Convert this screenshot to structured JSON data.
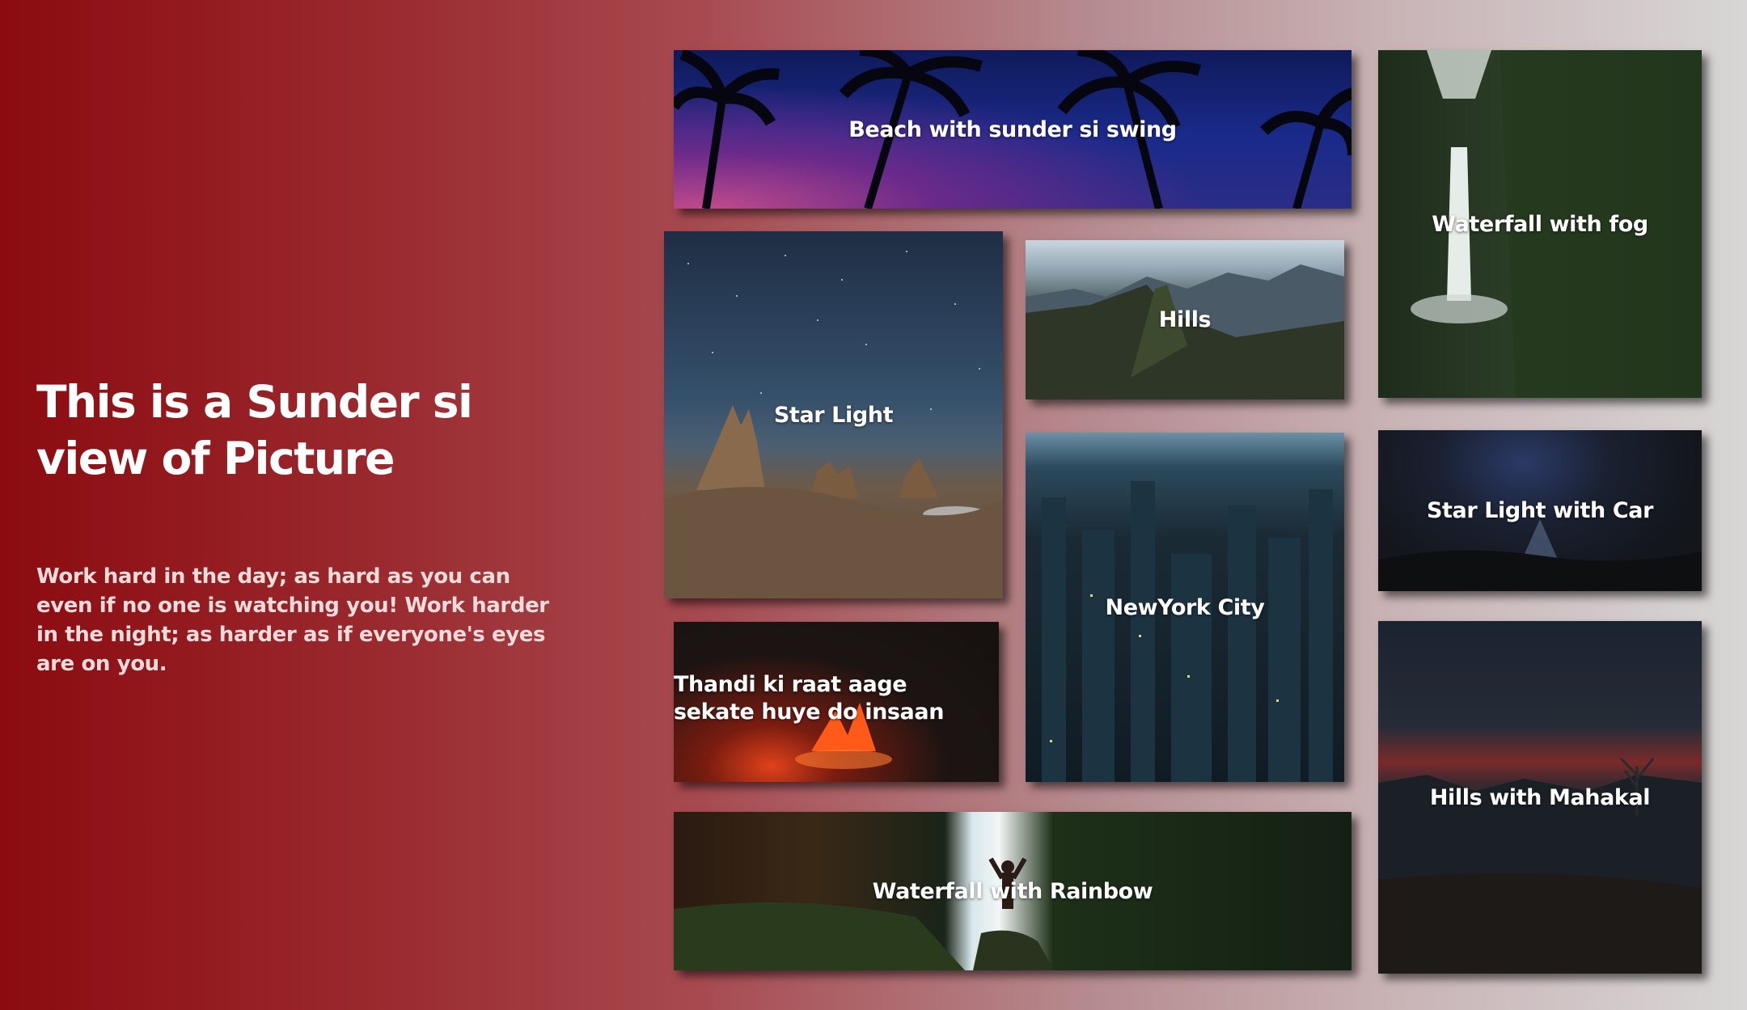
{
  "intro": {
    "headline": "This is a Sunder si view of Picture",
    "quote": "Work hard in the day; as hard as you can even if no one is watching you! Work harder in the night; as harder as if everyone's eyes are on you."
  },
  "gallery": [
    {
      "caption": "Beach with sunder si swing"
    },
    {
      "caption": "Star Light"
    },
    {
      "caption": "Hills"
    },
    {
      "caption": "Waterfall with fog"
    },
    {
      "caption": "NewYork City"
    },
    {
      "caption": "Star Light with Car"
    },
    {
      "caption": "Thandi ki raat aage sekate huye do insaan"
    },
    {
      "caption": "Waterfall with Rainbow"
    },
    {
      "caption": "Hills with Mahakal"
    }
  ]
}
